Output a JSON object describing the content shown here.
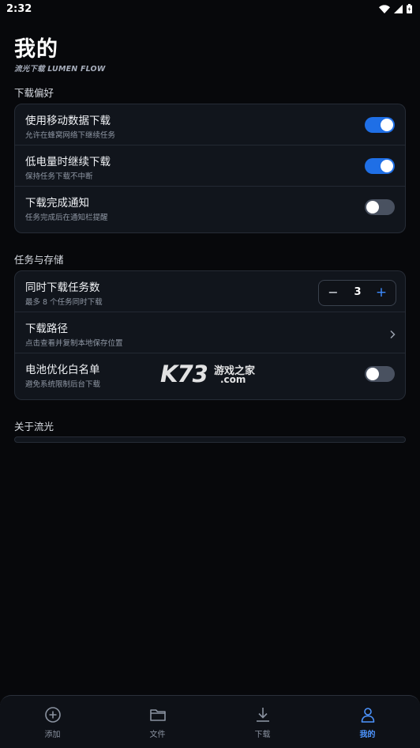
{
  "status_bar": {
    "time": "2:32",
    "icons": [
      "wifi-icon",
      "signal-icon",
      "battery-icon"
    ]
  },
  "header": {
    "title": "我的",
    "subtitle": "流光下载 LUMEN FLOW"
  },
  "sections": {
    "download_prefs": {
      "title": "下载偏好",
      "rows": [
        {
          "title": "使用移动数据下载",
          "desc": "允许在蜂窝网络下继续任务",
          "toggle": true
        },
        {
          "title": "低电量时继续下载",
          "desc": "保持任务下载不中断",
          "toggle": true
        },
        {
          "title": "下载完成通知",
          "desc": "任务完成后在通知栏提醒",
          "toggle": false
        }
      ]
    },
    "tasks_storage": {
      "title": "任务与存储",
      "concurrent": {
        "title": "同时下载任务数",
        "desc": "最多 8 个任务同时下载",
        "value": "3",
        "minus": "−",
        "plus": "+"
      },
      "path": {
        "title": "下载路径",
        "desc": "点击查看并复制本地保存位置"
      },
      "battery_whitelist": {
        "title": "电池优化白名单",
        "desc": "避免系统限制后台下载",
        "toggle": false
      }
    },
    "about": {
      "title": "关于流光"
    }
  },
  "watermark": {
    "logo": "K73",
    "name": "游戏之家",
    "domain": ".com"
  },
  "bottom_nav": {
    "items": [
      {
        "label": "添加",
        "icon": "add-circle-icon",
        "active": false
      },
      {
        "label": "文件",
        "icon": "folder-icon",
        "active": false
      },
      {
        "label": "下载",
        "icon": "download-icon",
        "active": false
      },
      {
        "label": "我的",
        "icon": "person-icon",
        "active": true
      }
    ]
  },
  "colors": {
    "background": "#07080b",
    "card": "#11151c",
    "accent": "#1f6fe6",
    "active_nav": "#4d95ff"
  }
}
